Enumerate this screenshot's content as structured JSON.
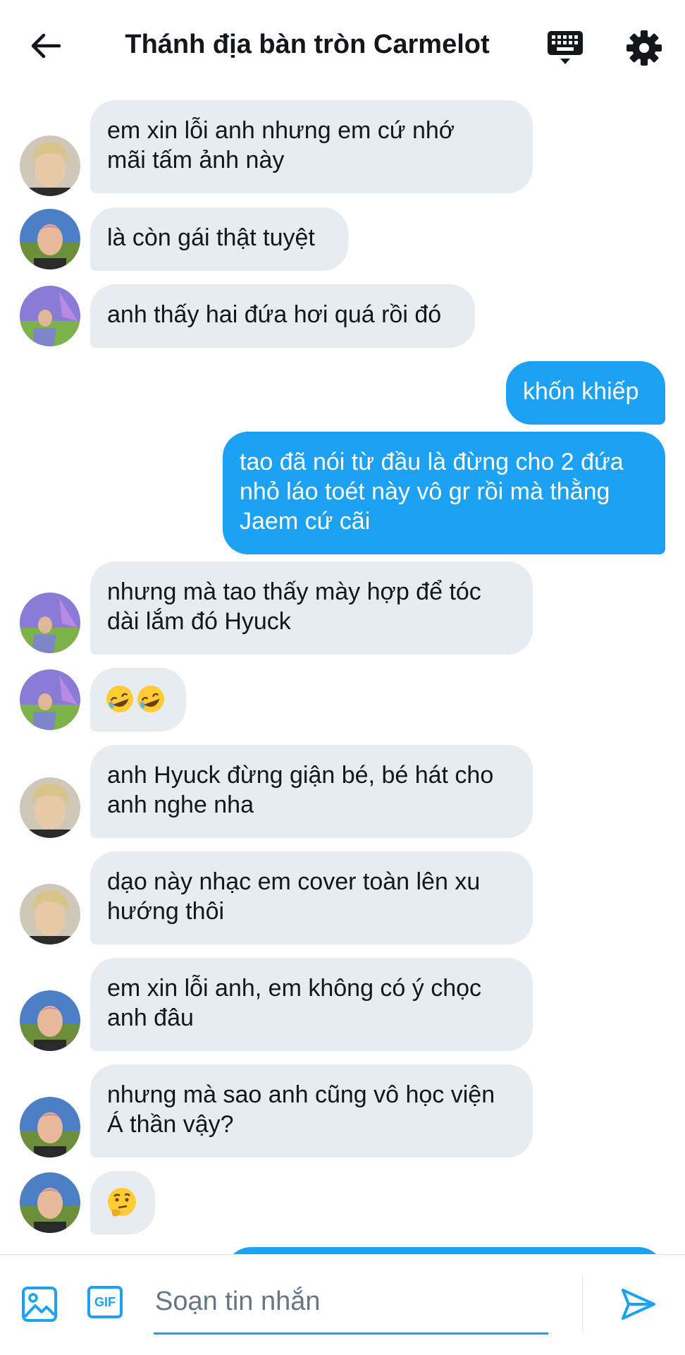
{
  "header": {
    "title": "Thánh địa bàn tròn Carmelot",
    "back_icon": "arrow-left-icon",
    "keyboard_icon": "keyboard-icon",
    "settings_icon": "gear-icon"
  },
  "colors": {
    "accent": "#1da1f2",
    "incoming_bubble": "#e6ecf0",
    "text": "#14171a"
  },
  "messages": [
    {
      "from": "other",
      "avatar": "avatar-blond-boy",
      "lines": [
        "em xin lỗi anh nhưng em cứ nhớ",
        "mãi tấm ảnh này"
      ]
    },
    {
      "from": "other",
      "avatar": "avatar-flower-boy",
      "lines": [
        "là còn gái thật tuyệt"
      ]
    },
    {
      "from": "other",
      "avatar": "avatar-purple-field",
      "lines": [
        "anh thấy hai đứa hơi quá rồi đó"
      ]
    },
    {
      "from": "me",
      "lines": [
        "khốn khiếp"
      ]
    },
    {
      "from": "me",
      "lines": [
        "tao đã nói từ đầu là đừng cho 2 đứa",
        "nhỏ láo toét này vô gr rồi mà thằng",
        "Jaem cứ cãi"
      ]
    },
    {
      "from": "other",
      "avatar": "avatar-purple-field",
      "lines": [
        "nhưng mà tao thấy mày hợp để tóc",
        "dài lắm đó Hyuck"
      ]
    },
    {
      "from": "other",
      "avatar": "avatar-purple-field",
      "emoji": "rolling-on-floor-laughing-emoji x2"
    },
    {
      "from": "other",
      "avatar": "avatar-blond-boy",
      "lines": [
        "anh Hyuck đừng giận bé, bé hát cho",
        "anh nghe nha"
      ]
    },
    {
      "from": "other",
      "avatar": "avatar-blond-boy",
      "lines": [
        "dạo này nhạc em cover toàn lên xu",
        "hướng thôi"
      ]
    },
    {
      "from": "other",
      "avatar": "avatar-flower-boy",
      "lines": [
        "em xin lỗi anh, em không có ý chọc",
        "anh đâu"
      ]
    },
    {
      "from": "other",
      "avatar": "avatar-flower-boy",
      "lines": [
        "nhưng mà sao anh cũng vô học viện",
        "Á thần vậy?"
      ]
    },
    {
      "from": "other",
      "avatar": "avatar-flower-boy",
      "emoji": "thinking-face-emoji"
    }
  ],
  "composer": {
    "placeholder": "Soạn tin nhắn",
    "image_icon": "image-icon",
    "gif_label": "GIF",
    "send_icon": "send-icon"
  }
}
